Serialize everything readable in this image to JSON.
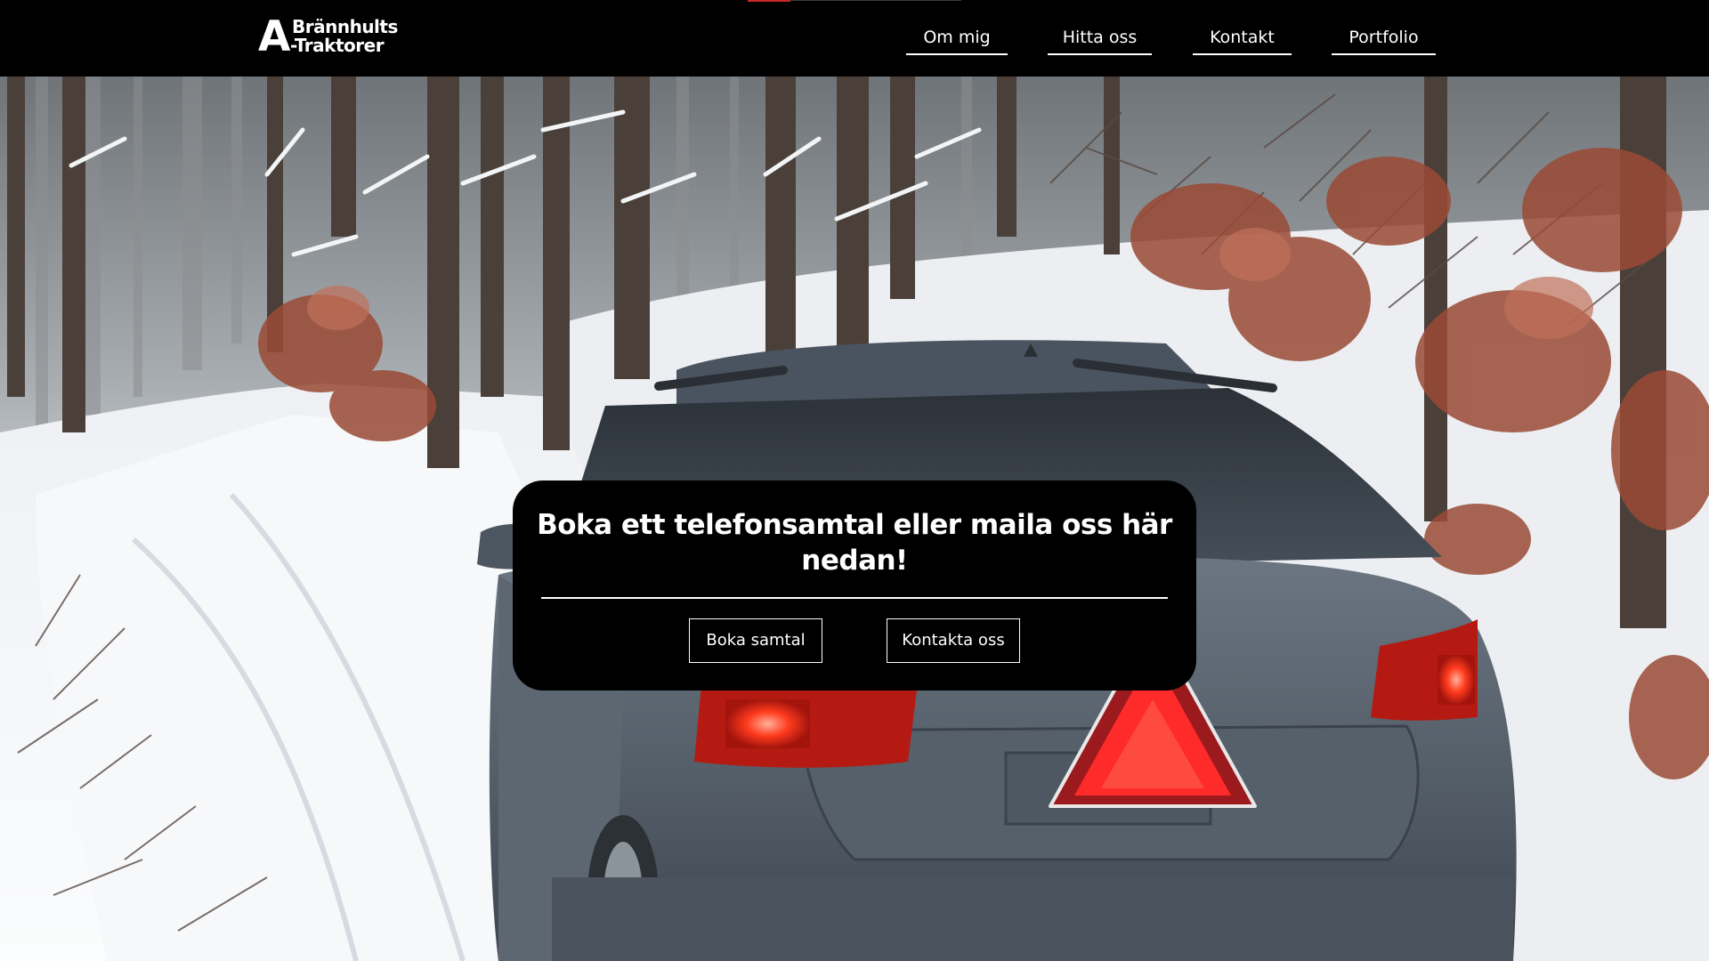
{
  "header": {
    "logo": {
      "initial": "A",
      "line1": "Brännhults",
      "line2": "-Traktorer"
    },
    "nav": [
      {
        "label": "Om mig"
      },
      {
        "label": "Hitta oss"
      },
      {
        "label": "Kontakt"
      },
      {
        "label": "Portfolio"
      }
    ]
  },
  "hero": {
    "background": "snowy-forest-road-with-car-and-slow-vehicle-sign",
    "cta": {
      "title": "Boka ett telefonsamtal eller maila oss här nedan!",
      "buttons": [
        {
          "label": "Boka samtal"
        },
        {
          "label": "Kontakta oss"
        }
      ]
    }
  },
  "colors": {
    "header_bg": "#000000",
    "card_bg": "#000000",
    "text": "#ffffff",
    "accent": "#c62828",
    "sign_red": "#ff2a2a"
  }
}
